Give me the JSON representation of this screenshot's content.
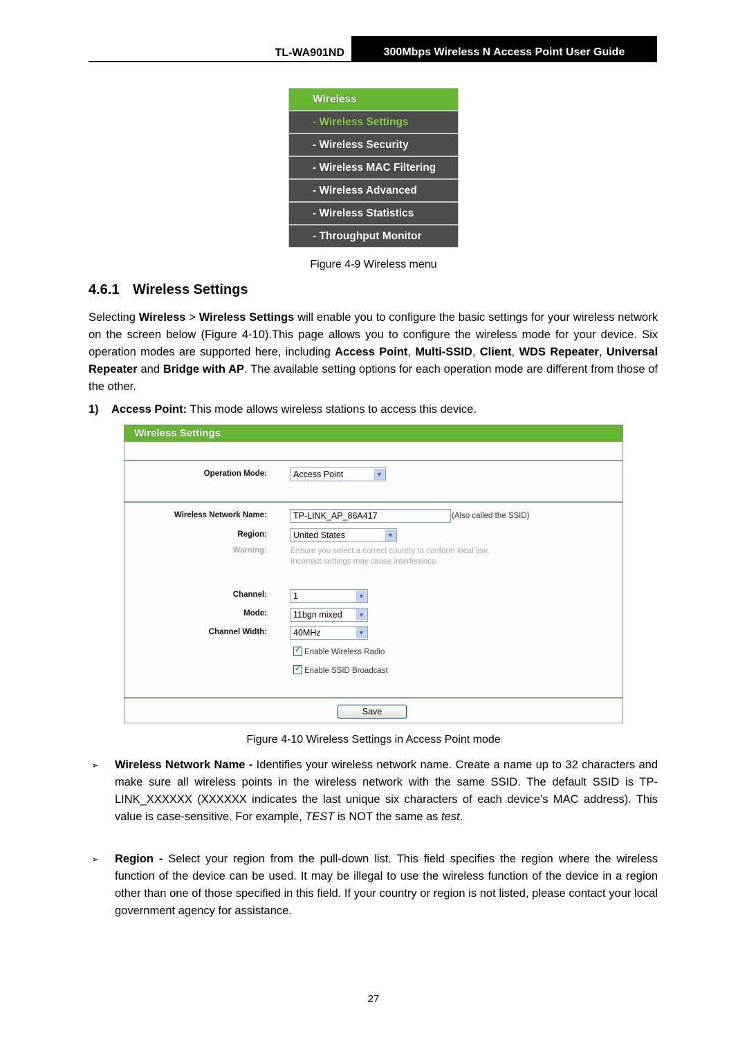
{
  "header": {
    "model": "TL-WA901ND",
    "guide_title": "300Mbps Wireless N Access Point User Guide"
  },
  "wireless_menu": {
    "items": [
      {
        "label": "Wireless",
        "type": "head"
      },
      {
        "label": "- Wireless Settings",
        "type": "sub",
        "active": true
      },
      {
        "label": "- Wireless Security",
        "type": "sub"
      },
      {
        "label": "- Wireless MAC Filtering",
        "type": "sub"
      },
      {
        "label": "- Wireless Advanced",
        "type": "sub"
      },
      {
        "label": "- Wireless Statistics",
        "type": "sub"
      },
      {
        "label": "- Throughput Monitor",
        "type": "sub"
      }
    ],
    "caption": "Figure 4-9 Wireless menu"
  },
  "section": {
    "number": "4.6.1",
    "title": "Wireless Settings"
  },
  "intro": {
    "p1": "Selecting ",
    "b1": "Wireless",
    "p2": " > ",
    "b2": "Wireless Settings",
    "p3": " will enable you to configure the basic settings for your wireless network on the screen below (Figure 4-10).This page allows you to configure the wireless mode for your device. Six operation modes are supported here, including ",
    "b3": "Access Point",
    "p4": ", ",
    "b4": "Multi-SSID",
    "p5": ", ",
    "b5": "Client",
    "p6": ", ",
    "b6": "WDS Repeater",
    "p7": ", ",
    "b7": "Universal Repeater",
    "p8": " and ",
    "b8": "Bridge with AP",
    "p9": ". The available setting options for each operation mode are different from those of the other."
  },
  "step1": {
    "number": "1)",
    "bold": "Access Point:",
    "text": " This mode allows wireless stations to access this device."
  },
  "settings_form": {
    "title": "Wireless Settings",
    "operation_mode_label": "Operation Mode:",
    "operation_mode_value": "Access Point",
    "ssid_label": "Wireless Network Name:",
    "ssid_value": "TP-LINK_AP_86A417",
    "ssid_note": "(Also called the SSID)",
    "region_label": "Region:",
    "region_value": "United States",
    "warning_label": "Warning:",
    "warning_line1": "Ensure you select a correct country to conform local law.",
    "warning_line2": "Incorrect settings may cause interference.",
    "channel_label": "Channel:",
    "channel_value": "1",
    "mode_label": "Mode:",
    "mode_value": "11bgn mixed",
    "width_label": "Channel Width:",
    "width_value": "40MHz",
    "enable_radio_label": "Enable Wireless Radio",
    "enable_radio_checked": true,
    "enable_ssid_label": "Enable SSID Broadcast",
    "enable_ssid_checked": true,
    "save_label": "Save",
    "dropdown_arrow": "chevron-down-icon",
    "caption": "Figure 4-10 Wireless Settings in Access Point mode"
  },
  "bullets": {
    "ssid": {
      "bold": "Wireless Network Name - ",
      "t1": "Identifies your wireless network name. Create a name up to 32 characters and make sure all wireless points in the wireless network with the same SSID. The default SSID is TP-LINK_XXXXXX (XXXXXX indicates the last unique six characters of each device’s MAC address). This value is case-sensitive. For example, ",
      "i1": "TEST",
      "t2": " is NOT the same as ",
      "i2": "test",
      "t3": "."
    },
    "region": {
      "bold": "Region - ",
      "t1": "Select your region from the pull-down list. This field specifies the region where the wireless function of the device can be used. It may be illegal to use the wireless function of the device in a region other than one of those specified in this field. If your country or region is not listed, please contact your local government agency for assistance."
    },
    "marker": "➢"
  },
  "page_number": "27"
}
